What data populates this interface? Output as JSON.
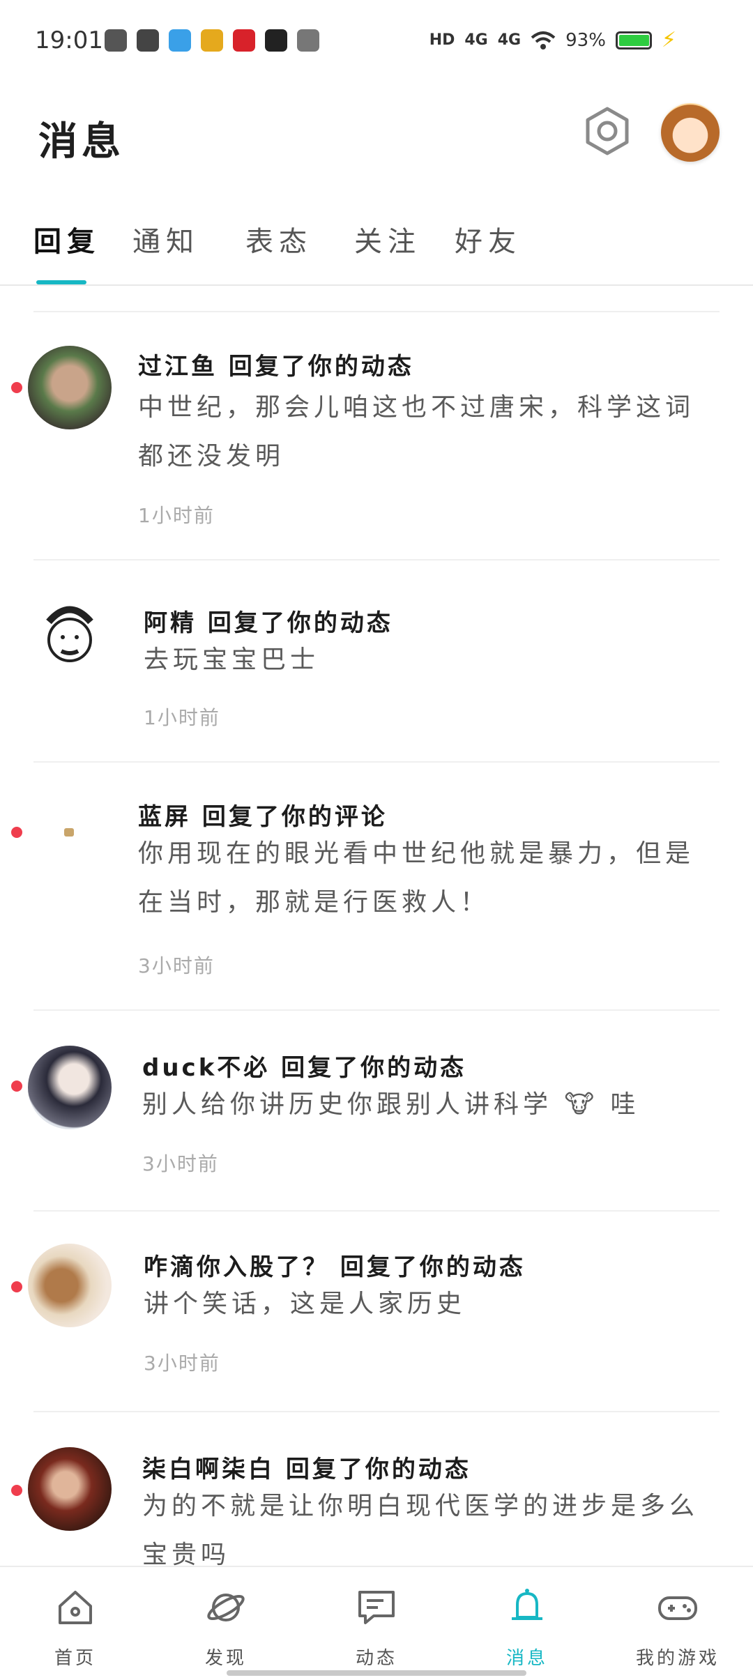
{
  "status_bar": {
    "time": "19:01",
    "hd": "HD",
    "net1": "4G",
    "net2": "4G",
    "battery": "93%",
    "battery_level": 0.93,
    "app_icons": [
      "qq-icon",
      "video-icon",
      "mihoyo-icon",
      "game-icon",
      "news-icon",
      "tiktok-icon",
      "weibo-icon"
    ]
  },
  "header": {
    "title": "消息",
    "settings_icon": "gear-icon"
  },
  "tabs": [
    {
      "label": "回复",
      "active": true
    },
    {
      "label": "通知",
      "active": false
    },
    {
      "label": "表态",
      "active": false
    },
    {
      "label": "关注",
      "active": false
    },
    {
      "label": "好友",
      "active": false
    }
  ],
  "messages": [
    {
      "user": "过江鱼",
      "action": "回复了你的动态",
      "body": "中世纪，那会儿咱这也不过唐宋，科学这词都还没发明",
      "time": "1小时前",
      "unread": true
    },
    {
      "user": "阿精",
      "action": "回复了你的动态",
      "body": "去玩宝宝巴士",
      "time": "1小时前",
      "unread": false
    },
    {
      "user": "蓝屏",
      "action": "回复了你的评论",
      "body": "你用现在的眼光看中世纪他就是暴力，但是在当时，那就是行医救人！",
      "time": "3小时前",
      "unread": true
    },
    {
      "user": "duck不必",
      "action": "回复了你的动态",
      "body": "别人给你讲历史你跟别人讲科学 🐮 哇",
      "time": "3小时前",
      "unread": true
    },
    {
      "user": "咋滴你入股了？",
      "action": "回复了你的动态",
      "body": "讲个笑话，这是人家历史",
      "time": "3小时前",
      "unread": true
    },
    {
      "user": "柒白啊柒白",
      "action": "回复了你的动态",
      "body": "为的不就是让你明白现代医学的进步是多么宝贵吗",
      "time": "",
      "unread": true
    }
  ],
  "bottom_nav": [
    {
      "label": "首页",
      "icon": "home-icon",
      "active": false
    },
    {
      "label": "发现",
      "icon": "planet-icon",
      "active": false
    },
    {
      "label": "动态",
      "icon": "chat-icon",
      "active": false
    },
    {
      "label": "消息",
      "icon": "bell-icon",
      "active": true
    },
    {
      "label": "我的游戏",
      "icon": "gamepad-icon",
      "active": false
    }
  ],
  "colors": {
    "accent": "#17b7c4",
    "unread": "#ef3d4d"
  }
}
